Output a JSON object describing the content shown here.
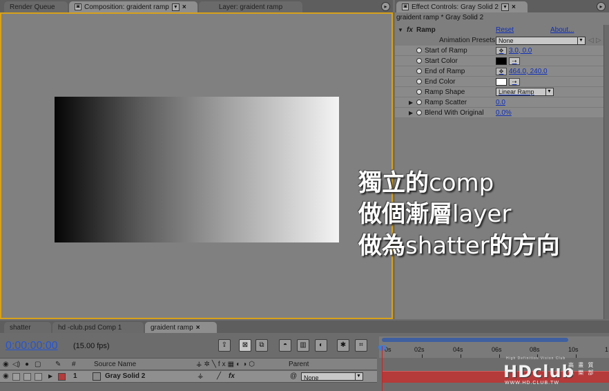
{
  "top_tabs": {
    "render_queue": "Render Queue",
    "composition": "Composition: graident ramp",
    "layer": "Layer: graident ramp",
    "effect_controls": "Effect Controls: Gray Solid 2"
  },
  "effect_controls": {
    "layer_title": "graident ramp * Gray Solid 2",
    "effect_name": "Ramp",
    "fx_badge": "fx",
    "reset_label": "Reset",
    "about_label": "About...",
    "presets_label": "Animation Presets:",
    "presets_value": "None",
    "properties": [
      {
        "label": "Start of Ramp",
        "value": "3.0, 0.0"
      },
      {
        "label": "Start Color",
        "color": "#000000"
      },
      {
        "label": "End of Ramp",
        "value": "464.0, 240.0"
      },
      {
        "label": "End Color",
        "color": "#ffffff"
      },
      {
        "label": "Ramp Shape",
        "select": "Linear Ramp"
      },
      {
        "label": "Ramp Scatter",
        "value": "0.0"
      },
      {
        "label": "Blend With Original",
        "value": "0.0%"
      }
    ]
  },
  "overlay_text": {
    "line1_cn": "獨立的",
    "line1_en": "comp",
    "line2_cn": "做個漸層",
    "line2_en": "layer",
    "line3_cn_a": "做為",
    "line3_en": "shatter",
    "line3_cn_b": "的方向"
  },
  "timeline": {
    "tabs": [
      "shatter",
      "hd -club.psd Comp 1",
      "graident ramp"
    ],
    "timecode": "0:00:00:00",
    "fps": "(15.00 fps)",
    "columns": {
      "num": "#",
      "source_name": "Source Name",
      "parent": "Parent"
    },
    "layer": {
      "num": "1",
      "name": "Gray Solid 2",
      "parent": "None",
      "fx": "fx"
    },
    "ruler_ticks": [
      "0s",
      "02s",
      "04s",
      "06s",
      "08s",
      "10s",
      "1"
    ]
  },
  "watermark": {
    "top": "High Definition Vision Club",
    "main": "HDclub",
    "sub": "WWW.HD.CLUB.TW",
    "cn": "高 畫 質 俱 樂 部"
  },
  "colors": {
    "accent_border": "#d8a21a",
    "link": "#0f2fb8",
    "timecode": "#2355d8",
    "layer_bar": "#b53a3a"
  }
}
